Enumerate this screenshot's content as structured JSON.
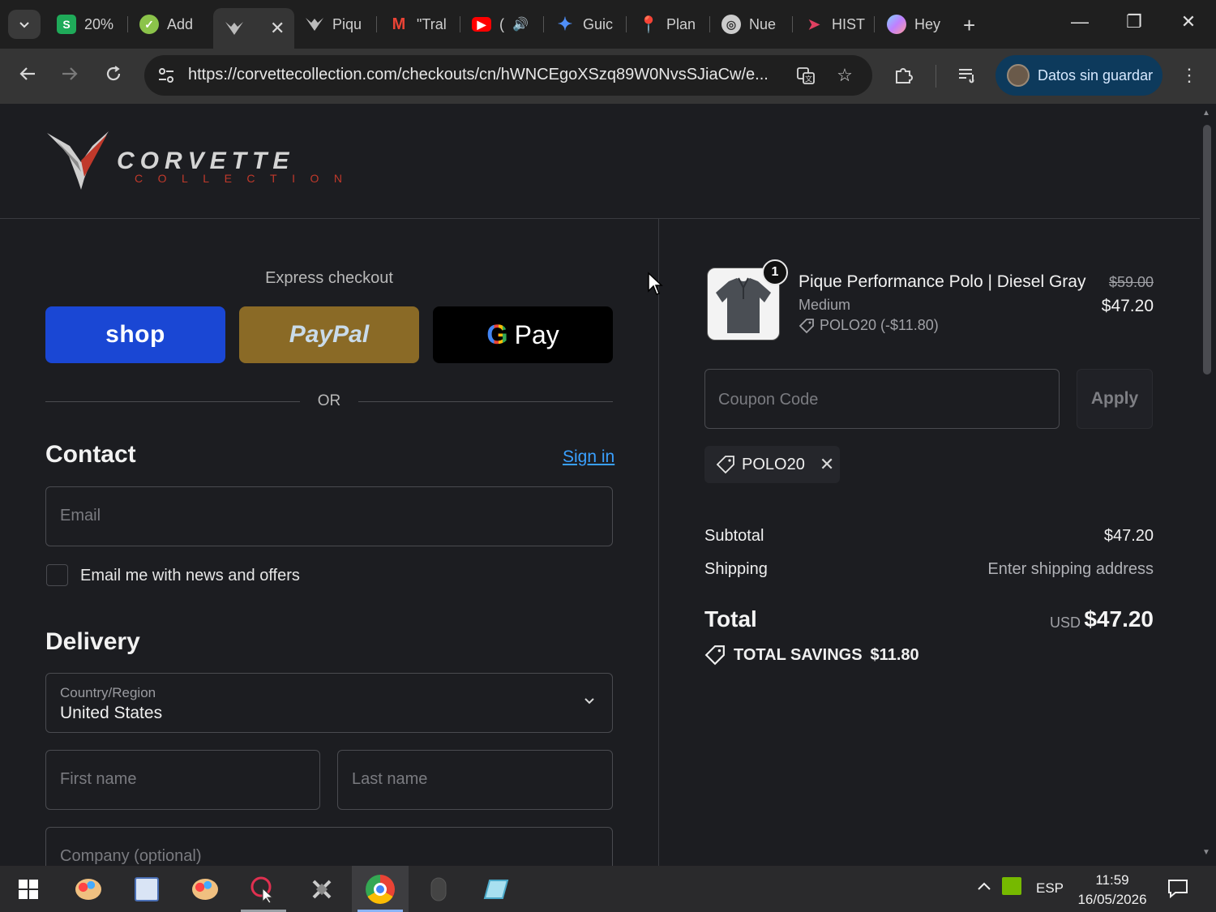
{
  "browser": {
    "tabs": [
      {
        "label": "20%",
        "icon": "s-icon",
        "color": "#1faa59"
      },
      {
        "label": "Add",
        "icon": "leaf-icon",
        "color": "#8bc34a"
      },
      {
        "label": "",
        "icon": "corvette-icon",
        "color": "#aaaaaa"
      },
      {
        "label": "Piqu",
        "icon": "corvette-icon",
        "color": "#aaaaaa"
      },
      {
        "label": "\"Tral",
        "icon": "gmail-icon",
        "color": "#ea4335"
      },
      {
        "label": "(",
        "icon": "youtube-icon",
        "color": "#ff0000"
      },
      {
        "label": "Guic",
        "icon": "gemini-icon",
        "color": "#4f8ef7"
      },
      {
        "label": "Plan",
        "icon": "pin-icon",
        "color": "#34a853"
      },
      {
        "label": "Nue",
        "icon": "chrome-icon",
        "color": "#cccccc"
      },
      {
        "label": "HIST",
        "icon": "ship-icon",
        "color": "#e04060"
      },
      {
        "label": "Hey",
        "icon": "gem-icon",
        "color": "#c080ff"
      }
    ],
    "url": "https://corvettecollection.com/checkouts/cn/hWNCEgoXSzq89W0NvsSJiaCw/e...",
    "profile_label": "Datos sin guardar"
  },
  "page": {
    "logo_text_1": "CORVETTE",
    "logo_text_2": "COLLECTION",
    "express_checkout": "Express checkout",
    "shop_label": "shop",
    "paypal_label": "PayPal",
    "gpay_g": "G",
    "gpay_label": "Pay",
    "or_label": "OR",
    "contact_title": "Contact",
    "sign_in": "Sign in",
    "email_placeholder": "Email",
    "news_checkbox_label": "Email me with news and offers",
    "delivery_title": "Delivery",
    "country_label": "Country/Region",
    "country_value": "United States",
    "first_name_placeholder": "First name",
    "last_name_placeholder": "Last name",
    "company_placeholder": "Company (optional)"
  },
  "summary": {
    "qty": "1",
    "product_name": "Pique Performance Polo | Diesel Gray",
    "variant": "Medium",
    "discount_line": "POLO20 (-$11.80)",
    "price_old": "$59.00",
    "price_new": "$47.20",
    "coupon_placeholder": "Coupon Code",
    "apply_label": "Apply",
    "applied_code": "POLO20",
    "subtotal_label": "Subtotal",
    "subtotal_value": "$47.20",
    "shipping_label": "Shipping",
    "shipping_value": "Enter shipping address",
    "total_label": "Total",
    "total_currency": "USD",
    "total_value": "$47.20",
    "savings_label": "TOTAL SAVINGS",
    "savings_value": "$11.80"
  },
  "taskbar": {
    "language": "ESP",
    "time": "11:59",
    "date": "16/05/2026"
  },
  "colors": {
    "shop": "#1a47d4",
    "paypal": "#8a6a26",
    "link": "#3aa0ff",
    "page_bg": "#1c1d21"
  }
}
